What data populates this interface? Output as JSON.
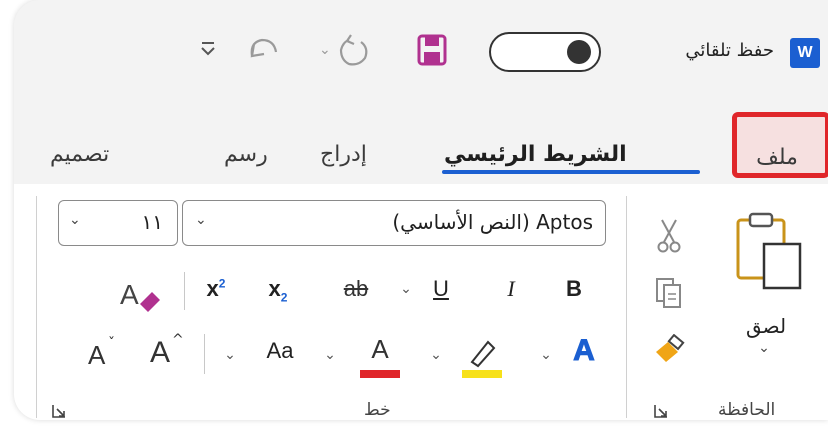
{
  "titlebar": {
    "app_icon_letter": "W",
    "autosave_label": "حفظ تلقائي",
    "autosave_state": "on"
  },
  "tabs": [
    {
      "label": "ملف"
    },
    {
      "label": "الشريط الرئيسي"
    },
    {
      "label": "إدراج"
    },
    {
      "label": "رسم"
    },
    {
      "label": "تصميم"
    }
  ],
  "clipboard": {
    "paste_label": "لصق",
    "group_label": "الحافظة"
  },
  "font": {
    "font_name": "Aptos (النص الأساسي)",
    "font_size": "١١",
    "group_label": "خط",
    "bold": "B",
    "italic": "I",
    "underline": "U",
    "strike": "ab",
    "subscript": "x",
    "superscript": "x",
    "change_case": "Aa",
    "grow": "A",
    "shrink": "A",
    "font_color": "A",
    "text_effects": "A"
  },
  "colors": {
    "accent": "#1b5fd1",
    "file_highlight": "#e0262a",
    "font_color": "#e0262a",
    "highlight_color": "#f7e11a",
    "save_icon": "#b0318f"
  }
}
